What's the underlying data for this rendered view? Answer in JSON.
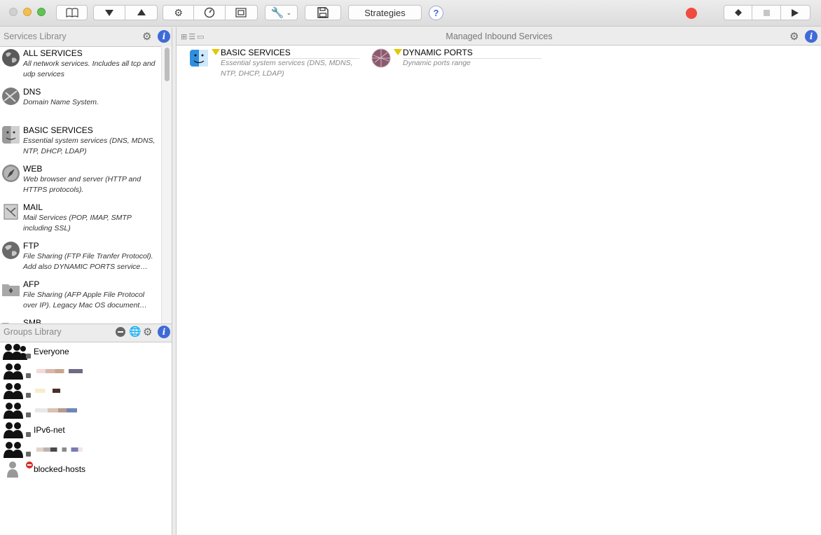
{
  "toolbar": {
    "strategies_label": "Strategies",
    "help_label": "?",
    "accent_record": "#f04b3e"
  },
  "services_library": {
    "title": "Services Library",
    "info": "i",
    "items": [
      {
        "name": "ALL SERVICES",
        "desc": "All network services. Includes all tcp and udp services",
        "icon": "globe-icon"
      },
      {
        "name": "DNS",
        "desc": "Domain Name System.",
        "icon": "dns-icon"
      },
      {
        "name": "BASIC SERVICES",
        "desc": "Essential system services (DNS, MDNS, NTP, DHCP, LDAP)",
        "icon": "finder-icon"
      },
      {
        "name": "WEB",
        "desc": "Web browser and server (HTTP and HTTPS protocols).",
        "icon": "compass-icon"
      },
      {
        "name": "MAIL",
        "desc": "Mail Services (POP, IMAP, SMTP including SSL)",
        "icon": "mail-icon"
      },
      {
        "name": "FTP",
        "desc": "File Sharing (FTP File Tranfer Protocol). Add also DYNAMIC PORTS service…",
        "icon": "globe-icon"
      },
      {
        "name": "AFP",
        "desc": "File Sharing  (AFP Apple File Protocol over IP). Legacy Mac OS document…",
        "icon": "folder-icon"
      },
      {
        "name": "SMB",
        "desc": "",
        "icon": "folder-icon"
      }
    ]
  },
  "groups_library": {
    "title": "Groups Library",
    "info": "i",
    "items": [
      {
        "name": "Everyone"
      },
      {
        "name": ""
      },
      {
        "name": ""
      },
      {
        "name": ""
      },
      {
        "name": "IPv6-net"
      },
      {
        "name": ""
      },
      {
        "name": "blocked-hosts"
      }
    ]
  },
  "managed": {
    "title": "Managed Inbound Services",
    "tiles": [
      {
        "name": "BASIC SERVICES",
        "desc": "Essential system services (DNS, MDNS, NTP, DHCP, LDAP)",
        "icon": "finder-icon"
      },
      {
        "name": "DYNAMIC PORTS",
        "desc": "Dynamic ports range",
        "icon": "network-sphere-icon"
      }
    ]
  }
}
